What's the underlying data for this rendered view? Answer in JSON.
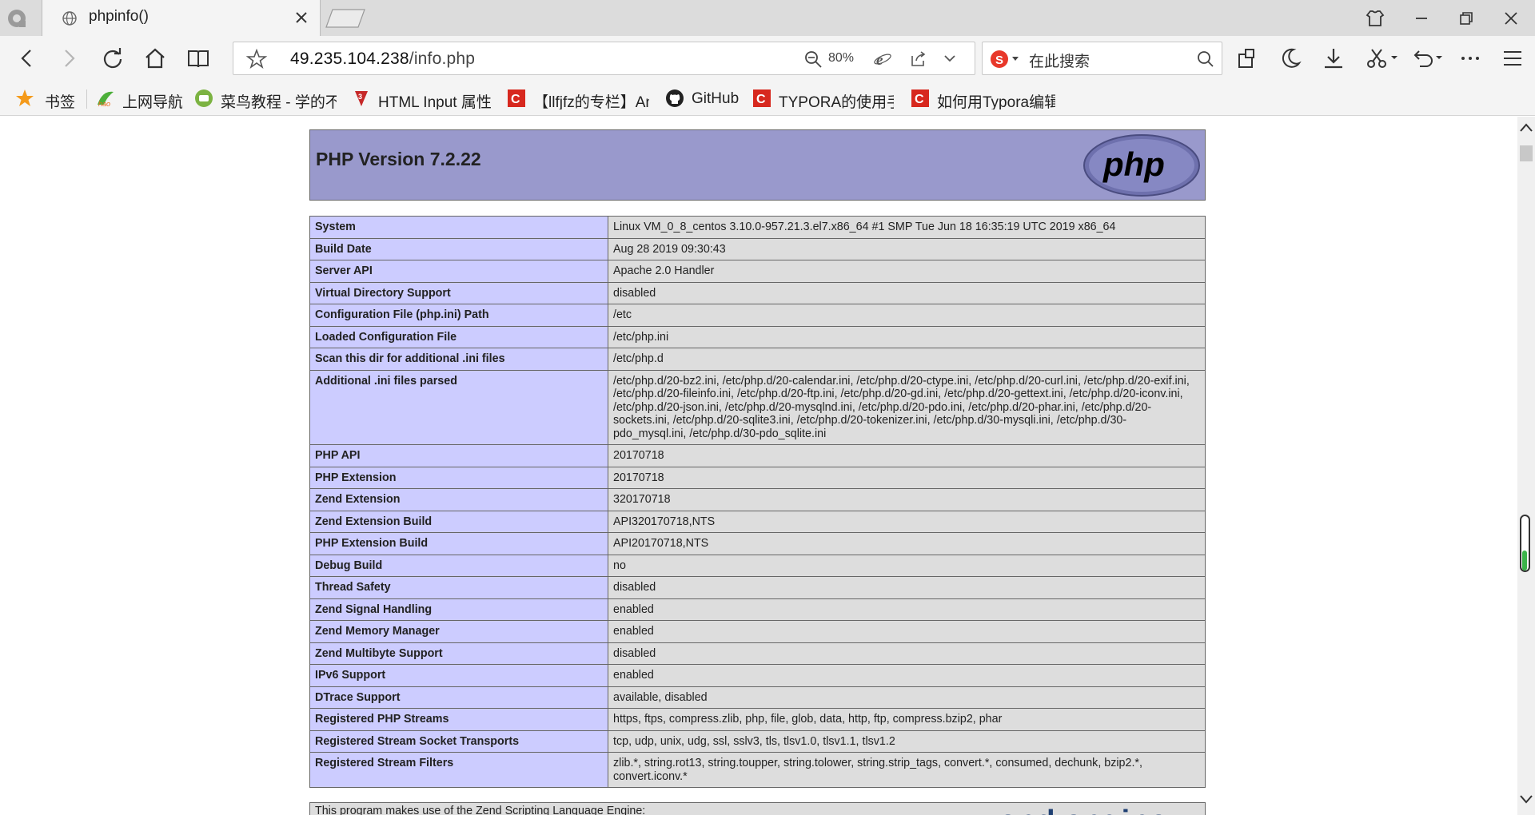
{
  "browser": {
    "tab_title": "phpinfo()",
    "address_host": "49.235.104.238",
    "address_path": "/info.php",
    "zoom": "80%",
    "search_placeholder": "在此搜索",
    "bookmarks": [
      {
        "label": "书签",
        "icon": "star-icon"
      },
      {
        "label": "上网导航",
        "icon": "hao-icon"
      },
      {
        "label": "菜鸟教程 - 学的不",
        "icon": "runoob-icon"
      },
      {
        "label": "HTML Input 属性",
        "icon": "w3school-icon"
      },
      {
        "label": "【llfjfz的专栏】An",
        "icon": "csdn-icon"
      },
      {
        "label": "GitHub",
        "icon": "github-icon"
      },
      {
        "label": "TYPORA的使用手",
        "icon": "csdn-icon"
      },
      {
        "label": "如何用Typora编辑",
        "icon": "csdn-icon"
      }
    ]
  },
  "page": {
    "php_version": "PHP Version 7.2.22",
    "logo_text": "php",
    "rows": [
      {
        "key": "System",
        "value": "Linux VM_0_8_centos 3.10.0-957.21.3.el7.x86_64 #1 SMP Tue Jun 18 16:35:19 UTC 2019 x86_64"
      },
      {
        "key": "Build Date",
        "value": "Aug 28 2019 09:30:43"
      },
      {
        "key": "Server API",
        "value": "Apache 2.0 Handler"
      },
      {
        "key": "Virtual Directory Support",
        "value": "disabled"
      },
      {
        "key": "Configuration File (php.ini) Path",
        "value": "/etc"
      },
      {
        "key": "Loaded Configuration File",
        "value": "/etc/php.ini"
      },
      {
        "key": "Scan this dir for additional .ini files",
        "value": "/etc/php.d"
      },
      {
        "key": "Additional .ini files parsed",
        "value": "/etc/php.d/20-bz2.ini, /etc/php.d/20-calendar.ini, /etc/php.d/20-ctype.ini, /etc/php.d/20-curl.ini, /etc/php.d/20-exif.ini, /etc/php.d/20-fileinfo.ini, /etc/php.d/20-ftp.ini, /etc/php.d/20-gd.ini, /etc/php.d/20-gettext.ini, /etc/php.d/20-iconv.ini, /etc/php.d/20-json.ini, /etc/php.d/20-mysqlnd.ini, /etc/php.d/20-pdo.ini, /etc/php.d/20-phar.ini, /etc/php.d/20-sockets.ini, /etc/php.d/20-sqlite3.ini, /etc/php.d/20-tokenizer.ini, /etc/php.d/30-mysqli.ini, /etc/php.d/30-pdo_mysql.ini, /etc/php.d/30-pdo_sqlite.ini"
      },
      {
        "key": "PHP API",
        "value": "20170718"
      },
      {
        "key": "PHP Extension",
        "value": "20170718"
      },
      {
        "key": "Zend Extension",
        "value": "320170718"
      },
      {
        "key": "Zend Extension Build",
        "value": "API320170718,NTS"
      },
      {
        "key": "PHP Extension Build",
        "value": "API20170718,NTS"
      },
      {
        "key": "Debug Build",
        "value": "no"
      },
      {
        "key": "Thread Safety",
        "value": "disabled"
      },
      {
        "key": "Zend Signal Handling",
        "value": "enabled"
      },
      {
        "key": "Zend Memory Manager",
        "value": "enabled"
      },
      {
        "key": "Zend Multibyte Support",
        "value": "disabled"
      },
      {
        "key": "IPv6 Support",
        "value": "enabled"
      },
      {
        "key": "DTrace Support",
        "value": "available, disabled"
      },
      {
        "key": "Registered PHP Streams",
        "value": "https, ftps, compress.zlib, php, file, glob, data, http, ftp, compress.bzip2, phar"
      },
      {
        "key": "Registered Stream Socket Transports",
        "value": "tcp, udp, unix, udg, ssl, sslv3, tls, tlsv1.0, tlsv1.1, tlsv1.2"
      },
      {
        "key": "Registered Stream Filters",
        "value": "zlib.*, string.rot13, string.toupper, string.tolower, string.strip_tags, convert.*, consumed, dechunk, bzip2.*, convert.iconv.*"
      }
    ],
    "zend_text": "This program makes use of the Zend Scripting Language Engine:",
    "zend_logo_text": "zend.engine"
  },
  "colors": {
    "header_bg": "#9999cc",
    "key_bg": "#ccccff",
    "value_bg": "#dddddd",
    "scroll_indicator": "#3bb34a"
  }
}
